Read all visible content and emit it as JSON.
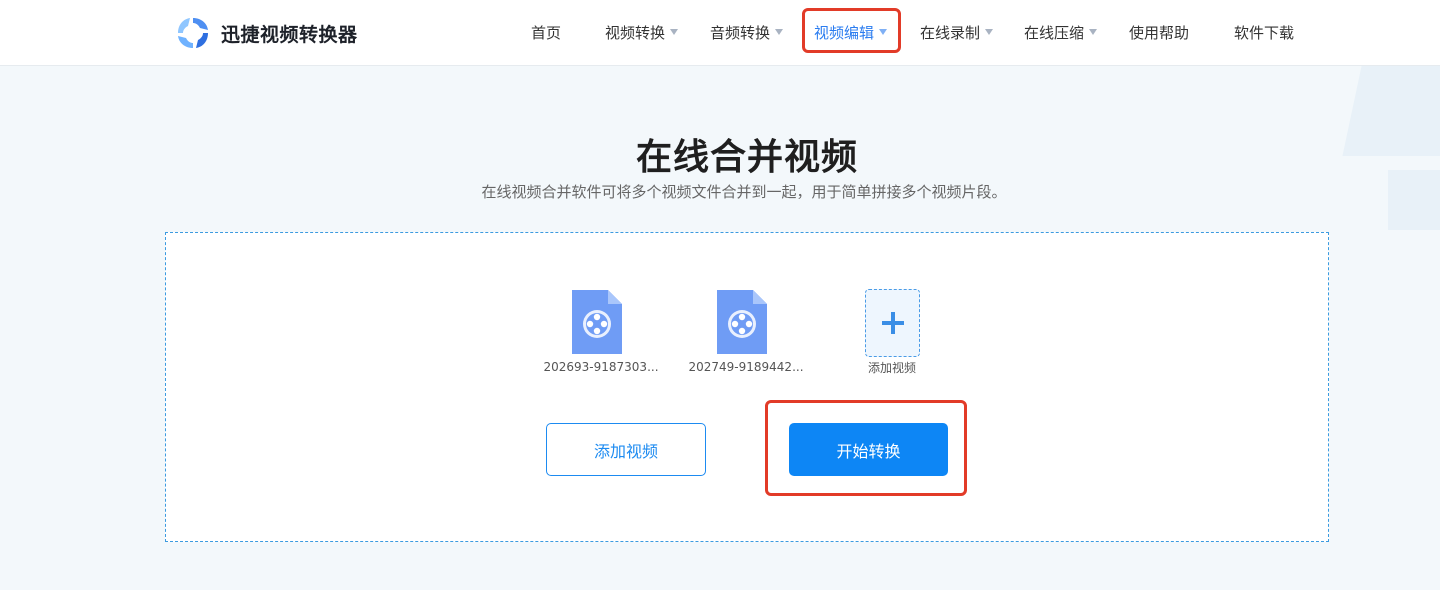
{
  "brand": {
    "name": "迅捷视频转换器",
    "logo_icon": "swirl-logo-icon"
  },
  "nav": {
    "items": [
      {
        "label": "首页",
        "has_dropdown": false,
        "active": false
      },
      {
        "label": "视频转换",
        "has_dropdown": true,
        "active": false
      },
      {
        "label": "音频转换",
        "has_dropdown": true,
        "active": false
      },
      {
        "label": "视频编辑",
        "has_dropdown": true,
        "active": true
      },
      {
        "label": "在线录制",
        "has_dropdown": true,
        "active": false
      },
      {
        "label": "在线压缩",
        "has_dropdown": true,
        "active": false
      },
      {
        "label": "使用帮助",
        "has_dropdown": false,
        "active": false
      },
      {
        "label": "软件下载",
        "has_dropdown": false,
        "active": false
      }
    ]
  },
  "main": {
    "title": "在线合并视频",
    "subtitle": "在线视频合并软件可将多个视频文件合并到一起，用于简单拼接多个视频片段。",
    "files": [
      {
        "name": "202693-9187303...",
        "icon": "video-file-icon"
      },
      {
        "name": "202749-9189442...",
        "icon": "video-file-icon"
      }
    ],
    "add_tile_label": "添加视频",
    "add_button_label": "添加视频",
    "start_button_label": "开始转换"
  },
  "colors": {
    "accent": "#0d86f5",
    "highlight": "#e23b28",
    "active_nav": "#2a7cf0",
    "background": "#f3f8fb"
  }
}
